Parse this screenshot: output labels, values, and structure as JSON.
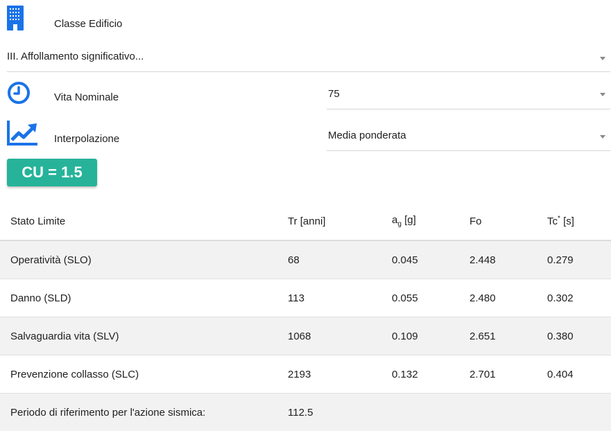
{
  "classe": {
    "label": "Classe Edificio",
    "value": "III. Affollamento significativo...",
    "icon": "building-icon"
  },
  "vita": {
    "label": "Vita Nominale",
    "value": "75",
    "icon": "clock-icon"
  },
  "interp": {
    "label": "Interpolazione",
    "value": "Media ponderata",
    "icon": "trending-up-icon"
  },
  "cu_badge": "CU = 1.5",
  "colors": {
    "accent": "#1a73e8",
    "badge": "#26b39a"
  },
  "table": {
    "headers": {
      "stato": "Stato Limite",
      "tr": "Tr [anni]",
      "ag_base": "a",
      "ag_sub": "g",
      "ag_unit": " [g]",
      "fo": "Fo",
      "tc_base": "Tc",
      "tc_sup": "*",
      "tc_unit": " [s]"
    },
    "rows": [
      {
        "stato": "Operatività (SLO)",
        "tr": "68",
        "ag": "0.045",
        "fo": "2.448",
        "tc": "0.279"
      },
      {
        "stato": "Danno (SLD)",
        "tr": "113",
        "ag": "0.055",
        "fo": "2.480",
        "tc": "0.302"
      },
      {
        "stato": "Salvaguardia vita (SLV)",
        "tr": "1068",
        "ag": "0.109",
        "fo": "2.651",
        "tc": "0.380"
      },
      {
        "stato": "Prevenzione collasso (SLC)",
        "tr": "2193",
        "ag": "0.132",
        "fo": "2.701",
        "tc": "0.404"
      }
    ],
    "periodo": {
      "label": "Periodo di riferimento per l'azione sismica:",
      "value": "112.5"
    }
  }
}
